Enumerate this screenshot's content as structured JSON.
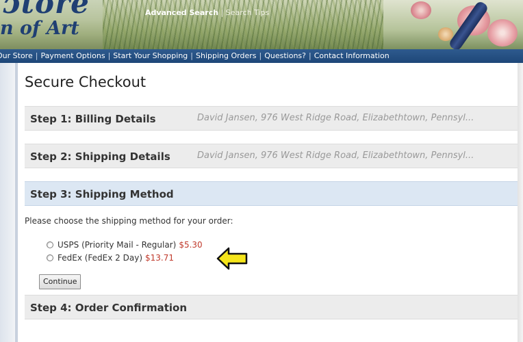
{
  "header": {
    "logo_top": "ɔtore",
    "logo_bottom": "n of Art",
    "advanced_search": "Advanced Search",
    "link_separator": "|",
    "search_tips": "Search Tips"
  },
  "nav": {
    "separator": "|",
    "items": [
      "Our Store",
      "Payment Options",
      "Start Your Shopping",
      "Shipping Orders",
      "Questions?",
      "Contact Information"
    ]
  },
  "page": {
    "title": "Secure Checkout"
  },
  "steps": {
    "step1": {
      "label": "Step 1: Billing Details",
      "summary": "David Jansen, 976 West Ridge Road, Elizabethtown, Pennsyl..."
    },
    "step2": {
      "label": "Step 2: Shipping Details",
      "summary": "David Jansen, 976 West Ridge Road, Elizabethtown, Pennsyl..."
    },
    "step3": {
      "label": "Step 3: Shipping Method",
      "instruction": "Please choose the shipping method for your order:",
      "options": [
        {
          "label": "USPS (Priority Mail - Regular)",
          "price": "$5.30",
          "selected": false
        },
        {
          "label": "FedEx (FedEx 2 Day)",
          "price": "$13.71",
          "selected": false
        }
      ],
      "continue_label": "Continue"
    },
    "step4": {
      "label": "Step 4: Order Confirmation"
    }
  },
  "colors": {
    "nav_bg": "#1e4778",
    "price": "#c0392b",
    "active_step_bg": "#dce7f3",
    "step_bg": "#ececec",
    "arrow_fill": "#f5e51b"
  }
}
